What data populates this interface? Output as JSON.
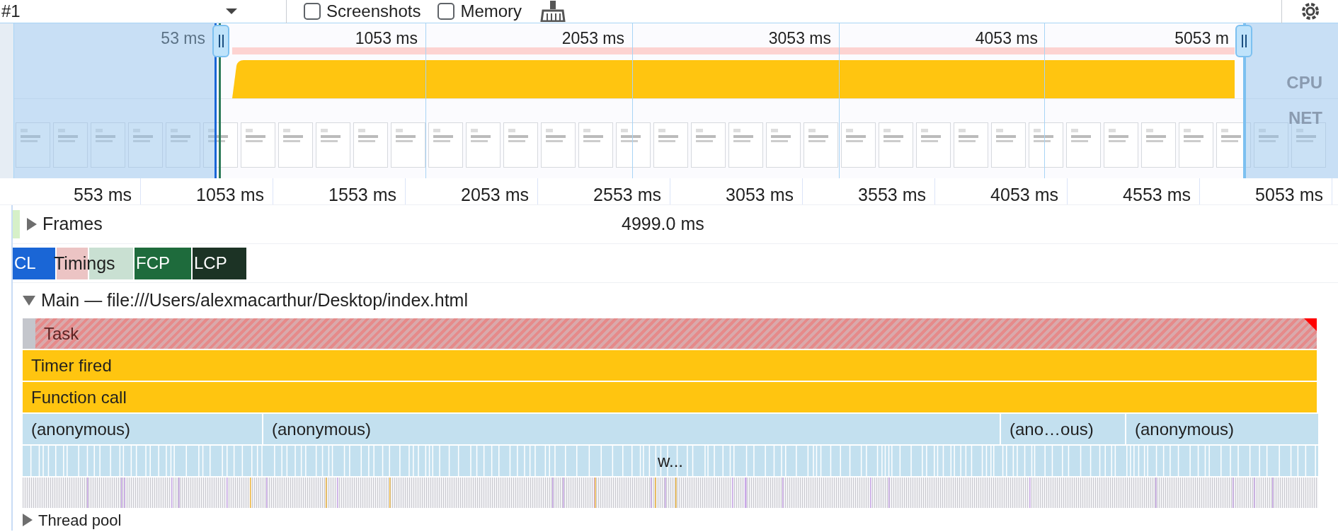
{
  "toolbar": {
    "recording": "#1",
    "checkboxes": [
      {
        "label": "Screenshots",
        "checked": false
      },
      {
        "label": "Memory",
        "checked": false
      }
    ]
  },
  "overview": {
    "ticks": [
      "53 ms",
      "1053 ms",
      "2053 ms",
      "3053 ms",
      "4053 ms",
      "5053 m"
    ],
    "tracks": [
      "CPU",
      "NET"
    ]
  },
  "ruler": [
    "553 ms",
    "1053 ms",
    "1553 ms",
    "2053 ms",
    "2553 ms",
    "3053 ms",
    "3553 ms",
    "4053 ms",
    "4553 ms",
    "5053 ms"
  ],
  "frames": {
    "label": "Frames",
    "expanded": false,
    "duration": "4999.0 ms"
  },
  "timings": {
    "label": "Timings",
    "markers": [
      {
        "text": "CL",
        "color": "#1a66d6"
      },
      {
        "color": "#ecc4c4"
      },
      {
        "color": "#c9e0d2"
      },
      {
        "text": "FCP",
        "color": "#1e6b3c"
      },
      {
        "text": "LCP",
        "color": "#1c3325"
      }
    ]
  },
  "main": {
    "label": "Main — file:///Users/alexmacarthur/Desktop/index.html",
    "expanded": true,
    "rows": [
      {
        "kind": "task",
        "events": [
          {
            "name": "Task",
            "long": true
          }
        ]
      },
      {
        "kind": "timer",
        "events": [
          {
            "name": "Timer fired"
          }
        ]
      },
      {
        "kind": "call",
        "events": [
          {
            "name": "Function call"
          }
        ]
      },
      {
        "kind": "script",
        "events": [
          {
            "name": "(anonymous)"
          },
          {
            "name": "(anonymous)"
          },
          {
            "name": "(ano…ous)"
          },
          {
            "name": "(anonymous)"
          }
        ]
      },
      {
        "kind": "dense",
        "events": [
          {
            "name": "w..."
          }
        ]
      },
      {
        "kind": "micro",
        "events": []
      }
    ]
  },
  "thread_pool": {
    "label": "Thread pool",
    "expanded": false
  }
}
